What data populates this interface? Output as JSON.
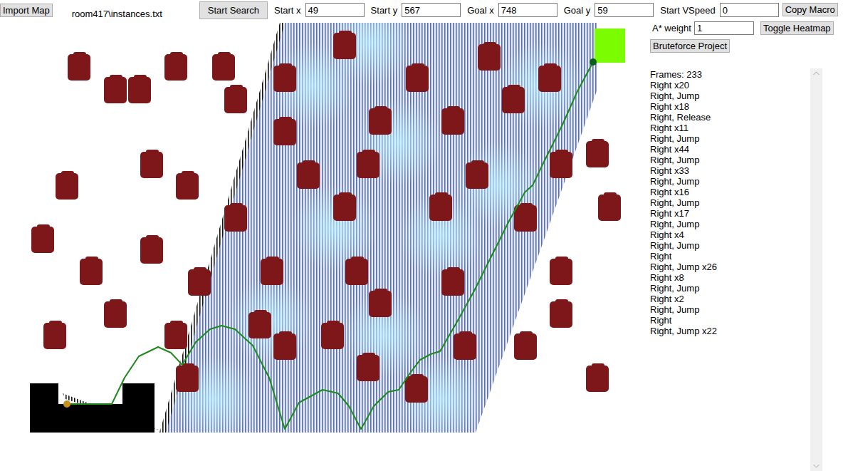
{
  "toolbar": {
    "import_button": "Import Map",
    "map_file": "room417\\instances.txt",
    "search_button": "Start Search",
    "fields": [
      {
        "label": "Start x",
        "value": "49"
      },
      {
        "label": "Start y",
        "value": "567"
      },
      {
        "label": "Goal x",
        "value": "748"
      },
      {
        "label": "Goal y",
        "value": "59"
      },
      {
        "label": "Start VSpeed",
        "value": "0"
      }
    ],
    "copy_button": "Copy Macro"
  },
  "side": {
    "astar_label": "A* weight",
    "astar_value": "1",
    "heatmap_button": "Toggle Heatmap",
    "bruteforce_button": "Bruteforce Project"
  },
  "macro": {
    "frames": "Frames: 233",
    "lines": [
      "Right x20",
      "Right, Jump",
      "Right x18",
      "Right, Release",
      "Right x11",
      "Right, Jump",
      "Right x44",
      "Right, Jump",
      "Right x33",
      "Right, Jump",
      "Right x16",
      "Right, Jump",
      "Right x17",
      "Right, Jump",
      "Right x4",
      "Right, Jump",
      "Right",
      "Right, Jump x26",
      "Right x8",
      "Right, Jump",
      "Right x2",
      "Right, Jump",
      "Right",
      "Right, Jump x22"
    ]
  },
  "map": {
    "heatmap": {
      "on": true
    }
  }
}
